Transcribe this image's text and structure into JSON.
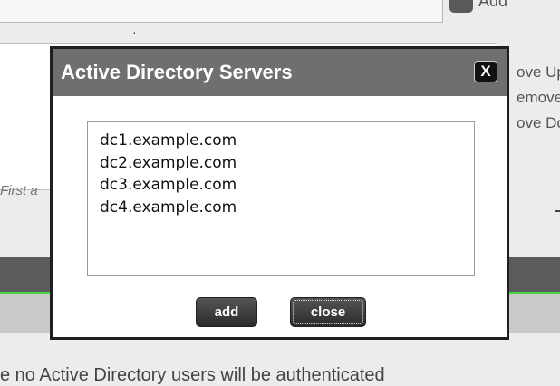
{
  "background": {
    "top_add_label": "Add",
    "dot": "·",
    "hint_text": "First a",
    "right_links": [
      "ove Up",
      "emove",
      "ove Do"
    ],
    "bottom_text": "e no Active Directory users will be authenticated"
  },
  "dialog": {
    "title": "Active Directory Servers",
    "close_icon_glyph": "X",
    "servers": [
      "dc1.example.com",
      "dc2.example.com",
      "dc3.example.com",
      "dc4.example.com"
    ],
    "add_label": "add",
    "close_label": "close"
  },
  "colors": {
    "header_bg": "#6f6f6f",
    "button_bg": "#333333",
    "accent_green": "#45d645",
    "dark_bar": "#5b5b5b"
  }
}
